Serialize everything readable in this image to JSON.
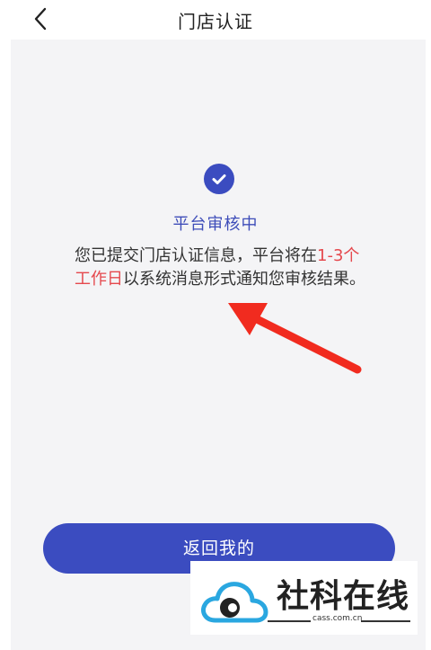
{
  "header": {
    "title": "门店认证"
  },
  "status": {
    "title": "平台审核中",
    "desc_part1": "您已提交门店认证信息，平台将在",
    "desc_highlight": "1-3个工作日",
    "desc_part2": "以系统消息形式通知您审核结果。"
  },
  "actions": {
    "return_label": "返回我的"
  },
  "watermark": {
    "name": "社科在线",
    "domain": "cass.com.cn"
  },
  "colors": {
    "accent": "#3b4cc0",
    "highlight": "#e5484d",
    "arrow": "#f12b1f",
    "panel": "#f4f4f6"
  },
  "icons": {
    "back": "chevron-left-icon",
    "status": "check-circle-icon",
    "annotation": "red-arrow"
  }
}
